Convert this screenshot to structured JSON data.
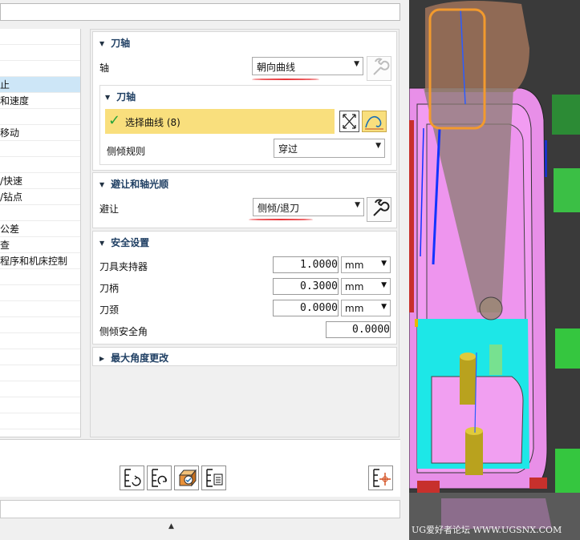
{
  "left_tree": {
    "items": [
      "",
      "",
      "",
      "止",
      "和速度",
      "",
      "移动",
      "",
      "",
      "/快速",
      "/钻点",
      "",
      "公差",
      "查",
      "程序和机床控制",
      "",
      "",
      "",
      "",
      "",
      "",
      "",
      "",
      "",
      ""
    ],
    "selected_index": 3
  },
  "tool_axis_group": {
    "title": "刀轴",
    "axis_label": "轴",
    "axis_value": "朝向曲线"
  },
  "inner_tool_axis_group": {
    "title": "刀轴",
    "select_curve_label": "选择曲线 (8)",
    "tilt_rule_label": "侧倾规则",
    "tilt_rule_value": "穿过"
  },
  "avoidance_group": {
    "title": "避让和轴光顺",
    "avoid_label": "避让",
    "avoid_value": "侧倾/退刀"
  },
  "safety_group": {
    "title": "安全设置",
    "holder_label": "刀具夹持器",
    "holder_value": "1.0000",
    "holder_unit": "mm",
    "shank_label": "刀柄",
    "shank_value": "0.3000",
    "shank_unit": "mm",
    "neck_label": "刀颈",
    "neck_value": "0.0000",
    "neck_unit": "mm",
    "tilt_safety_label": "侧倾安全角",
    "tilt_safety_value": "0.0000"
  },
  "max_angle_group": {
    "title": "最大角度更改"
  },
  "watermark": "UG爱好者论坛 WWW.UGSNX.COM",
  "colors": {
    "highlight": "#f9df7d",
    "accent_blue": "#1f3f63",
    "underline_red": "#e8373b",
    "viewport_pink": "#ef9bef",
    "viewport_cyan": "#1de7e7"
  }
}
